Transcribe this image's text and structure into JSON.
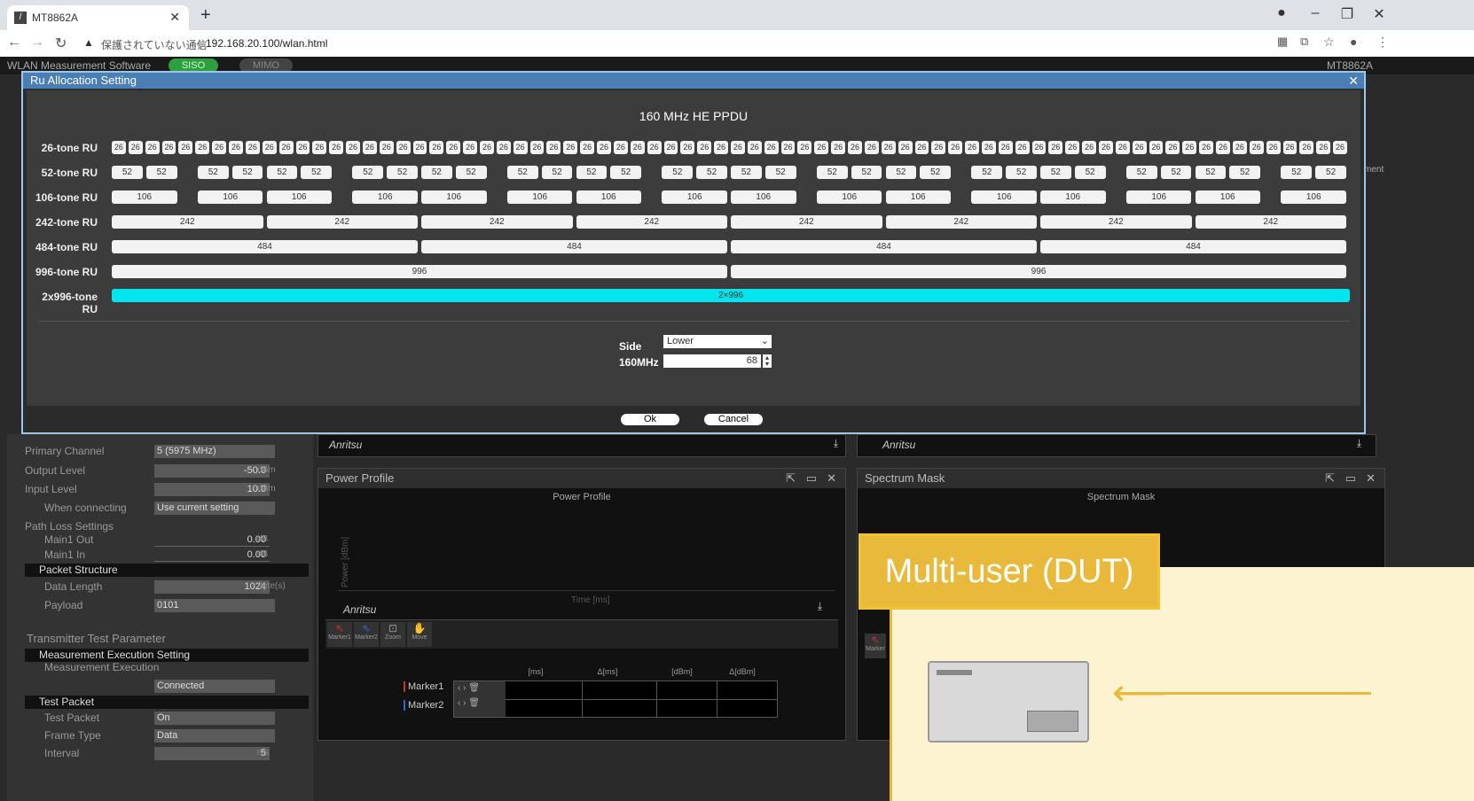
{
  "browser": {
    "tab_title": "MT8862A",
    "tab_icon": "anritsu-favicon",
    "not_secure_text": "保護されていない通信",
    "url": "192.168.20.100/wlan.html"
  },
  "app": {
    "title": "WLAN Measurement Software",
    "siso": "SISO",
    "mimo": "MIMO",
    "brand": "MT8862A"
  },
  "dialog": {
    "title": "Ru Allocation Setting",
    "heading": "160 MHz HE PPDU",
    "rows": {
      "r26": "26-tone RU",
      "r52": "52-tone RU",
      "r106": "106-tone RU",
      "r242": "242-tone RU",
      "r484": "484-tone RU",
      "r996": "996-tone RU",
      "r2x996": "2x996-tone RU"
    },
    "ru_values": {
      "v26": "26",
      "v52": "52",
      "v106": "106",
      "v242": "242",
      "v484": "484",
      "v996": "996",
      "v2x996": "2×996"
    },
    "selected_row": "2x996-tone RU",
    "side_label": "Side",
    "side_value": "Lower",
    "mhz_label": "160MHz",
    "mhz_value": "68",
    "ok": "Ok",
    "cancel": "Cancel"
  },
  "left_panel": {
    "primary_channel_label": "Primary Channel",
    "primary_channel_value": "5 (5975 MHz)",
    "output_level_label": "Output Level",
    "output_level_value": "-50.0",
    "input_level_label": "Input Level",
    "input_level_value": "10.0",
    "dbm": "dBm",
    "when_connecting_label": "When connecting",
    "when_connecting_value": "Use current setting",
    "path_loss_label": "Path Loss Settings",
    "main1_out_label": "Main1 Out",
    "main1_out_value": "0.00",
    "main1_in_label": "Main1 In",
    "main1_in_value": "0.00",
    "db": "dB",
    "packet_structure": "Packet Structure",
    "data_length_label": "Data Length",
    "data_length_value": "1024",
    "bytes": "Byte(s)",
    "payload_label": "Payload",
    "payload_value": "0101",
    "tx_test_param": "Transmitter Test Parameter",
    "meas_exec_setting": "Measurement Execution Setting",
    "meas_exec_label": "Measurement Execution",
    "meas_exec_value": "Connected",
    "test_packet_section": "Test Packet",
    "test_packet_label": "Test Packet",
    "test_packet_value": "On",
    "frame_type_label": "Frame Type",
    "frame_type_value": "Data",
    "interval_label": "Interval",
    "interval_value": "5",
    "ms": "ms"
  },
  "panels": {
    "brand": "Anritsu",
    "power_profile_title": "Power Profile",
    "power_profile_chart_title": "Power Profile",
    "power_y_label": "Power [dBm]",
    "time_x_label": "Time [ms]",
    "spectrum_mask_title": "Spectrum Mask",
    "spectrum_mask_chart_title": "Spectrum Mask",
    "tools": [
      "Marker1",
      "Marker2",
      "Zoom",
      "Move"
    ],
    "marker": "Marker",
    "marker_table_headers": [
      "[ms]",
      "Δ[ms]",
      "[dBm]",
      "Δ[dBm]"
    ],
    "marker_rows": [
      "Marker1",
      "Marker2"
    ],
    "side_text": "ment"
  },
  "callout": {
    "text": "Multi-user (DUT)"
  },
  "colors": {
    "selected_ru": "#00e5ee",
    "dialog_header": "#4a7fb5",
    "callout": "#e8b93a"
  }
}
